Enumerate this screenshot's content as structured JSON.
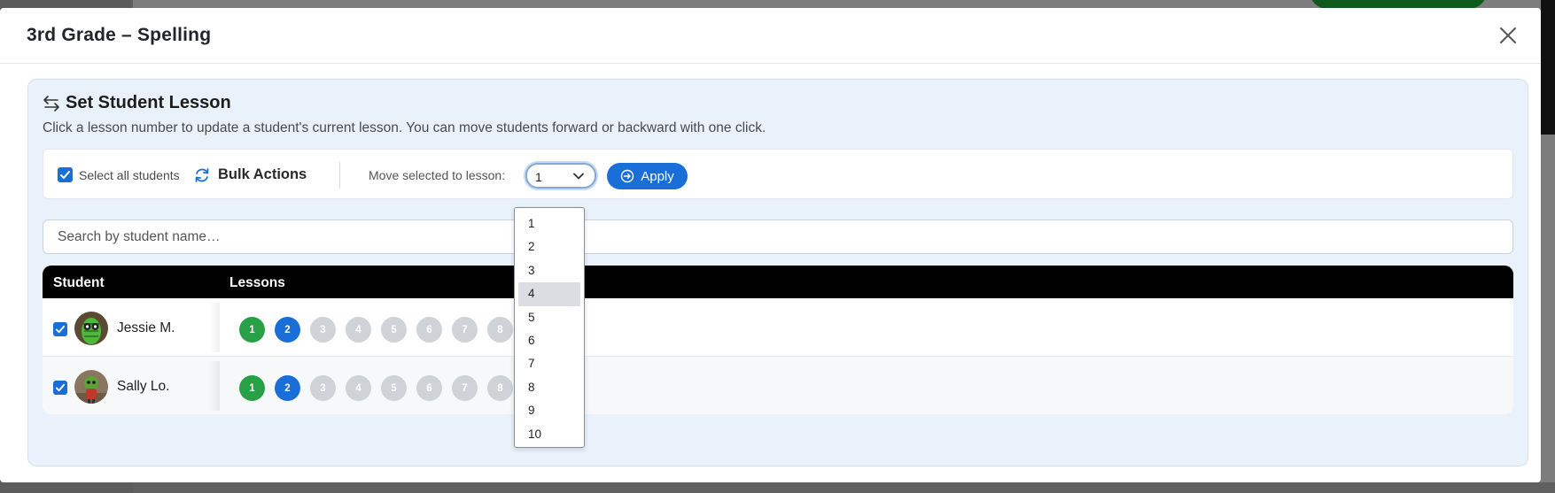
{
  "modal": {
    "title": "3rd Grade – Spelling"
  },
  "panel": {
    "title": "Set Student Lesson",
    "description": "Click a lesson number to update a student's current lesson. You can move students forward or backward with one click."
  },
  "toolbar": {
    "select_all_label": "Select all students",
    "bulk_actions_label": "Bulk Actions",
    "move_label": "Move selected to lesson:",
    "selected_lesson": "1",
    "apply_label": "Apply"
  },
  "search": {
    "placeholder": "Search by student name…"
  },
  "table": {
    "headers": {
      "student": "Student",
      "lessons": "Lessons"
    },
    "rows": [
      {
        "name": "Jessie M.",
        "checked": true,
        "completed": 1,
        "current": 2,
        "lessons": [
          "1",
          "2",
          "3",
          "4",
          "5",
          "6",
          "7",
          "8"
        ]
      },
      {
        "name": "Sally Lo.",
        "checked": true,
        "completed": 1,
        "current": 2,
        "lessons": [
          "1",
          "2",
          "3",
          "4",
          "5",
          "6",
          "7",
          "8"
        ]
      }
    ]
  },
  "dropdown": {
    "options": [
      "1",
      "2",
      "3",
      "4",
      "5",
      "6",
      "7",
      "8",
      "9",
      "10"
    ],
    "highlighted": "4"
  },
  "colors": {
    "primary": "#1a6ed8",
    "completed": "#27a046",
    "future": "#cfd3d8",
    "panel_bg": "#e9f2fb",
    "table_header": "#000000"
  },
  "icons": [
    "close-icon",
    "swap-arrows-icon",
    "sync-icon",
    "chevron-down-icon",
    "arrow-circle-right-icon",
    "checkbox-checked-icon"
  ]
}
